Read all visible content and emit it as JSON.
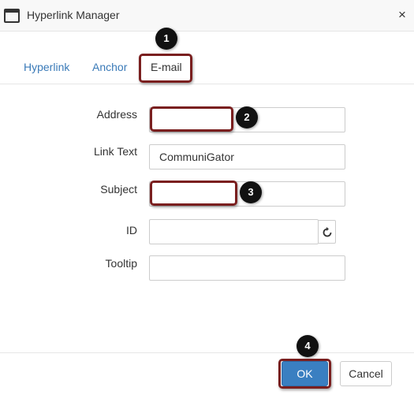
{
  "window": {
    "title": "Hyperlink Manager",
    "close_label": "×"
  },
  "tabs": [
    {
      "label": "Hyperlink",
      "active": false
    },
    {
      "label": "Anchor",
      "active": false
    },
    {
      "label": "E-mail",
      "active": true
    }
  ],
  "form": {
    "address": {
      "label": "Address",
      "value": ""
    },
    "link_text": {
      "label": "Link Text",
      "value": "CommuniGator"
    },
    "subject": {
      "label": "Subject",
      "value": ""
    },
    "id": {
      "label": "ID",
      "value": ""
    },
    "tooltip": {
      "label": "Tooltip",
      "value": ""
    }
  },
  "buttons": {
    "ok": "OK",
    "cancel": "Cancel"
  },
  "callouts": [
    "1",
    "2",
    "3",
    "4"
  ],
  "colors": {
    "accent": "#3a7fc1",
    "highlight": "#7a1f1f",
    "link": "#3a7ab8"
  },
  "icons": {
    "window": "window-icon",
    "close": "close-icon",
    "refresh": "refresh-icon"
  }
}
